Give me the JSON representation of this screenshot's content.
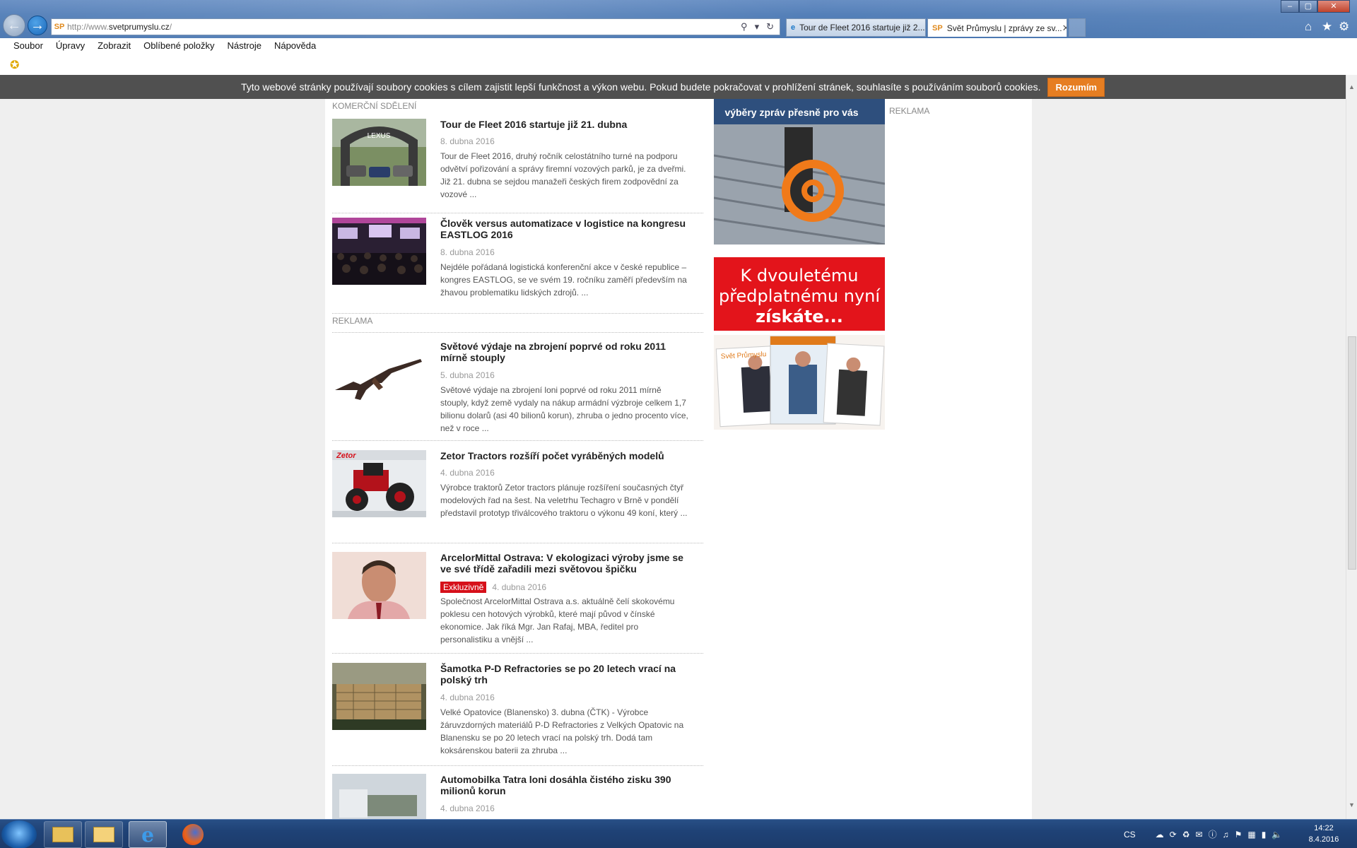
{
  "browser": {
    "address": {
      "prefix": "http://www.",
      "domain": "svetprumyslu.cz",
      "suffix": "/"
    },
    "address_favicon": "SP",
    "tabs": [
      {
        "label": "Tour de Fleet 2016 startuje již 2...",
        "favicon": "e"
      },
      {
        "label": "Svět Průmyslu | zprávy ze sv...",
        "favicon": "SP",
        "close": "✕"
      }
    ],
    "menu": [
      "Soubor",
      "Úpravy",
      "Zobrazit",
      "Oblíbené položky",
      "Nástroje",
      "Nápověda"
    ]
  },
  "cookie_bar": {
    "message": "Tyto webové stránky používají soubory cookies s cílem zajistit lepší funkčnost a výkon webu. Pokud budete pokračovat v prohlížení stránek, souhlasíte s používáním souborů cookies.",
    "button": "Rozumím"
  },
  "page": {
    "section_commercial": "KOMERČNÍ SDĚLENÍ",
    "section_ad": "REKLAMA",
    "sidebar_ad_label": "REKLAMA",
    "ad1_text": "výběry zpráv přesně pro vás",
    "ad2_line1": "K dvouletému",
    "ad2_line2": "předplatnému nyní",
    "ad2_line3": "získáte...",
    "ad3_mag_title": "Svět Průmyslu",
    "articles": [
      {
        "title": "Tour de Fleet 2016 startuje již 21. dubna",
        "date": "8. dubna 2016",
        "excerpt": "Tour de Fleet 2016, druhý ročník celostátního turné na podporu odvětví pořizování a správy firemní vozových parků, je za dveřmi. Již 21. dubna se sejdou manažeři českých firem zodpovědní za vozové ..."
      },
      {
        "title": "Člověk versus automatizace v logistice na kongresu EASTLOG 2016",
        "date": "8. dubna 2016",
        "excerpt": "Nejdéle pořádaná logistická konferenční akce v české republice – kongres EASTLOG, se ve svém 19. ročníku zaměří především na žhavou problematiku lidských zdrojů. ..."
      },
      {
        "title": "Světové výdaje na zbrojení poprvé od roku 2011 mírně stouply",
        "date": "5. dubna 2016",
        "excerpt": "Světové výdaje na zbrojení loni poprvé od roku 2011 mírně stouply, když země vydaly na nákup armádní výzbroje celkem 1,7 bilionu dolarů (asi 40 bilionů korun), zhruba o jedno procento více, než v roce ..."
      },
      {
        "title": "Zetor Tractors rozšíří počet vyráběných modelů",
        "date": "4. dubna 2016",
        "excerpt": "Výrobce traktorů Zetor tractors plánuje rozšíření současných čtyř modelových řad na šest. Na veletrhu Techagro v Brně v pondělí představil prototyp třiválcového traktoru o výkonu 49 koní, který ..."
      },
      {
        "title": "ArcelorMittal Ostrava: V ekologizaci výroby jsme se ve své třídě zařadili mezi světovou špičku",
        "date": "4. dubna 2016",
        "badge": "Exkluzivně",
        "excerpt": "Společnost ArcelorMittal Ostrava a.s. aktuálně čelí skokovému poklesu cen hotových výrobků, které mají původ v čínské ekonomice. Jak říká Mgr. Jan Rafaj, MBA, ředitel pro personalistiku a vnější ..."
      },
      {
        "title": "Šamotka P-D Refractories se po 20 letech vrací na polský trh",
        "date": "4. dubna 2016",
        "excerpt": "Velké Opatovice (Blanensko) 3. dubna (ČTK) - Výrobce žáruvzdorných materiálů P-D Refractories z Velkých Opatovic na Blanensku se po 20 letech vrací na polský trh. Dodá tam koksárenskou baterii za zhruba ..."
      },
      {
        "title": "Automobilka Tatra loni dosáhla čistého zisku 390 milionů korun",
        "date": "4. dubna 2016",
        "excerpt": ""
      }
    ]
  },
  "taskbar": {
    "language": "CS",
    "time": "14:22",
    "date": "8.4.2016"
  },
  "colors": {
    "accent": "#e67e22",
    "badge": "#d6101a",
    "ad_red": "#e3141b",
    "cookie_bg": "#505050"
  }
}
